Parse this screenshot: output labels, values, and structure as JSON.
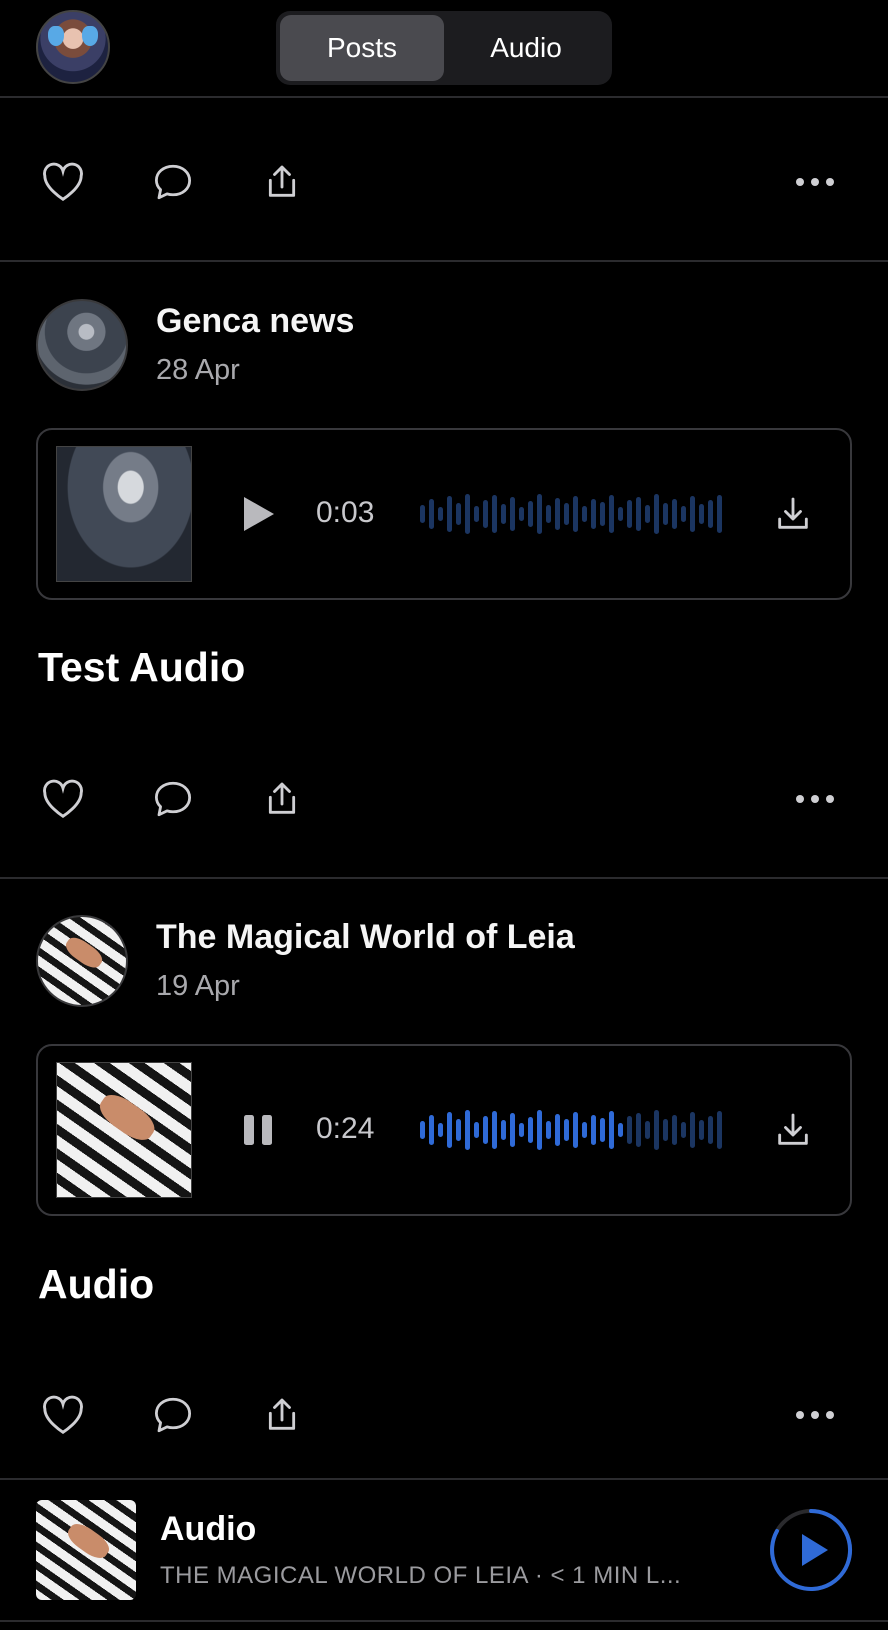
{
  "tabs": [
    {
      "label": "Posts",
      "active": true
    },
    {
      "label": "Audio",
      "active": false
    }
  ],
  "posts": [
    {
      "author": "Genca news",
      "date": "28 Apr",
      "audio": {
        "time": "0:03",
        "state": "paused",
        "progress": 0
      },
      "title": "Test Audio"
    },
    {
      "author": "The Magical World of Leia",
      "date": "19 Apr",
      "audio": {
        "time": "0:24",
        "state": "playing",
        "progress": 0.66
      },
      "title": "Audio"
    }
  ],
  "mini_player": {
    "title": "Audio",
    "subtitle": "THE MAGICAL WORLD OF LEIA · < 1 MIN L...",
    "state": "paused"
  },
  "colors": {
    "accent": "#2f6ad7",
    "waveform_inactive": "#1b3561",
    "background": "#000000"
  },
  "icons": [
    "heart-icon",
    "comment-icon",
    "share-icon",
    "more-icon",
    "play-icon",
    "pause-icon",
    "download-icon"
  ]
}
